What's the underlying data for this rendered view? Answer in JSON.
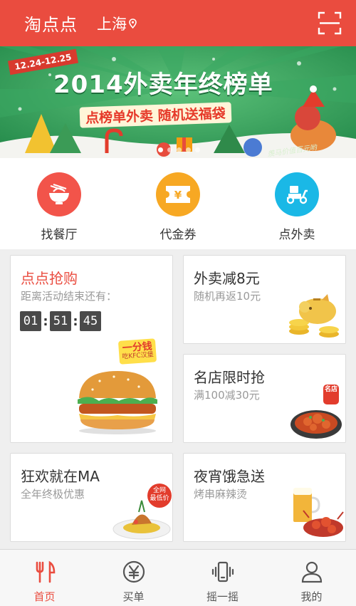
{
  "header": {
    "app_title": "淘点点",
    "city": "上海",
    "icons": {
      "location": "location-pin-icon",
      "scan": "scan-icon"
    }
  },
  "banner": {
    "date_range": "12.24-12.25",
    "title": "2014外卖年终榜单",
    "subtitle": "点榜单外卖 随机送福袋",
    "note": "羡马价值百元哟",
    "slide_count": 5,
    "active_slide": 1
  },
  "categories": [
    {
      "label": "找餐厅",
      "icon": "bowl-icon",
      "color": "#f2544a"
    },
    {
      "label": "代金券",
      "icon": "voucher-icon",
      "color": "#f7a823"
    },
    {
      "label": "点外卖",
      "icon": "scooter-icon",
      "color": "#1ab8e6"
    }
  ],
  "cards": {
    "flash_sale": {
      "title": "点点抢购",
      "subtitle": "距离活动结束还有：",
      "timer": {
        "hours": "01",
        "minutes": "51",
        "seconds": "45",
        "separator": ":"
      },
      "sticker_main": "一分钱",
      "sticker_sub": "吃KFC汉堡"
    },
    "delivery_discount": {
      "title": "外卖减8元",
      "subtitle": "随机再返10元"
    },
    "famous_stores": {
      "title": "名店限时抢",
      "subtitle": "满100减30元",
      "badge": "名店"
    },
    "carnival": {
      "title": "狂欢就在MA",
      "subtitle": "全年终极优惠",
      "badge_line1": "全网",
      "badge_line2": "最低价"
    },
    "late_night": {
      "title": "夜宵饿急送",
      "subtitle": "烤串麻辣烫"
    }
  },
  "nav": [
    {
      "label": "首页",
      "icon": "fork-knife-icon",
      "active": true
    },
    {
      "label": "买单",
      "icon": "yen-circle-icon",
      "active": false
    },
    {
      "label": "摇一摇",
      "icon": "shake-phone-icon",
      "active": false
    },
    {
      "label": "我的",
      "icon": "person-icon",
      "active": false
    }
  ],
  "colors": {
    "accent": "#ea4c3f",
    "background": "#efefef",
    "timer_box": "#4a4a4a"
  }
}
